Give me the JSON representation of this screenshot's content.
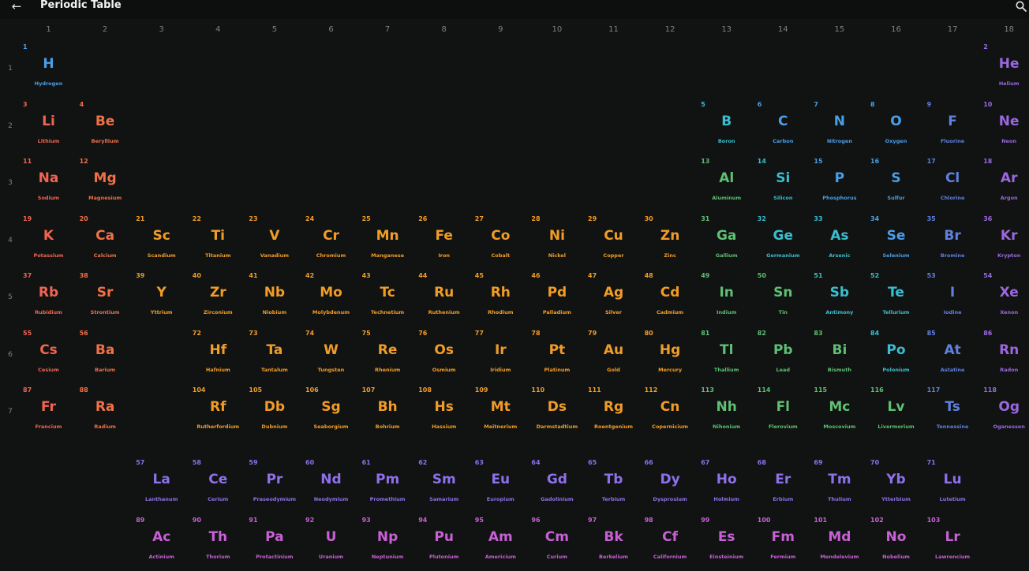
{
  "header": {
    "title": "Periodic Table",
    "back_icon": "arrow-left-icon",
    "search_icon": "search-icon"
  },
  "groups": [
    "1",
    "2",
    "3",
    "4",
    "5",
    "6",
    "7",
    "8",
    "9",
    "10",
    "11",
    "12",
    "13",
    "14",
    "15",
    "16",
    "17",
    "18"
  ],
  "periods": [
    "1",
    "2",
    "3",
    "4",
    "5",
    "6",
    "7"
  ],
  "colors": {
    "alkali": "#f06452",
    "alkaline": "#f07048",
    "transition": "#f29c28",
    "post": "#5fbf75",
    "metalloid": "#3bbdd0",
    "nonmetal": "#4a9ee8",
    "halogen": "#6080e0",
    "noble": "#9a68e0",
    "lanthanide": "#8f70ec",
    "actinide": "#c860d6"
  },
  "elements": [
    {
      "n": "1",
      "s": "H",
      "name": "Hydrogen",
      "g": 1,
      "p": 1,
      "c": "nonmetal"
    },
    {
      "n": "2",
      "s": "He",
      "name": "Helium",
      "g": 18,
      "p": 1,
      "c": "noble"
    },
    {
      "n": "3",
      "s": "Li",
      "name": "Lithium",
      "g": 1,
      "p": 2,
      "c": "alkali"
    },
    {
      "n": "4",
      "s": "Be",
      "name": "Beryllium",
      "g": 2,
      "p": 2,
      "c": "alkaline"
    },
    {
      "n": "5",
      "s": "B",
      "name": "Boron",
      "g": 13,
      "p": 2,
      "c": "metalloid"
    },
    {
      "n": "6",
      "s": "C",
      "name": "Carbon",
      "g": 14,
      "p": 2,
      "c": "nonmetal"
    },
    {
      "n": "7",
      "s": "N",
      "name": "Nitrogen",
      "g": 15,
      "p": 2,
      "c": "nonmetal"
    },
    {
      "n": "8",
      "s": "O",
      "name": "Oxygen",
      "g": 16,
      "p": 2,
      "c": "nonmetal"
    },
    {
      "n": "9",
      "s": "F",
      "name": "Fluorine",
      "g": 17,
      "p": 2,
      "c": "halogen"
    },
    {
      "n": "10",
      "s": "Ne",
      "name": "Neon",
      "g": 18,
      "p": 2,
      "c": "noble"
    },
    {
      "n": "11",
      "s": "Na",
      "name": "Sodium",
      "g": 1,
      "p": 3,
      "c": "alkali"
    },
    {
      "n": "12",
      "s": "Mg",
      "name": "Magnesium",
      "g": 2,
      "p": 3,
      "c": "alkaline"
    },
    {
      "n": "13",
      "s": "Al",
      "name": "Aluminum",
      "g": 13,
      "p": 3,
      "c": "post"
    },
    {
      "n": "14",
      "s": "Si",
      "name": "Silicon",
      "g": 14,
      "p": 3,
      "c": "metalloid"
    },
    {
      "n": "15",
      "s": "P",
      "name": "Phosphorus",
      "g": 15,
      "p": 3,
      "c": "nonmetal"
    },
    {
      "n": "16",
      "s": "S",
      "name": "Sulfur",
      "g": 16,
      "p": 3,
      "c": "nonmetal"
    },
    {
      "n": "17",
      "s": "Cl",
      "name": "Chlorine",
      "g": 17,
      "p": 3,
      "c": "halogen"
    },
    {
      "n": "18",
      "s": "Ar",
      "name": "Argon",
      "g": 18,
      "p": 3,
      "c": "noble"
    },
    {
      "n": "19",
      "s": "K",
      "name": "Potassium",
      "g": 1,
      "p": 4,
      "c": "alkali"
    },
    {
      "n": "20",
      "s": "Ca",
      "name": "Calcium",
      "g": 2,
      "p": 4,
      "c": "alkaline"
    },
    {
      "n": "21",
      "s": "Sc",
      "name": "Scandium",
      "g": 3,
      "p": 4,
      "c": "transition"
    },
    {
      "n": "22",
      "s": "Ti",
      "name": "Titanium",
      "g": 4,
      "p": 4,
      "c": "transition"
    },
    {
      "n": "23",
      "s": "V",
      "name": "Vanadium",
      "g": 5,
      "p": 4,
      "c": "transition"
    },
    {
      "n": "24",
      "s": "Cr",
      "name": "Chromium",
      "g": 6,
      "p": 4,
      "c": "transition"
    },
    {
      "n": "25",
      "s": "Mn",
      "name": "Manganese",
      "g": 7,
      "p": 4,
      "c": "transition"
    },
    {
      "n": "26",
      "s": "Fe",
      "name": "Iron",
      "g": 8,
      "p": 4,
      "c": "transition"
    },
    {
      "n": "27",
      "s": "Co",
      "name": "Cobalt",
      "g": 9,
      "p": 4,
      "c": "transition"
    },
    {
      "n": "28",
      "s": "Ni",
      "name": "Nickel",
      "g": 10,
      "p": 4,
      "c": "transition"
    },
    {
      "n": "29",
      "s": "Cu",
      "name": "Copper",
      "g": 11,
      "p": 4,
      "c": "transition"
    },
    {
      "n": "30",
      "s": "Zn",
      "name": "Zinc",
      "g": 12,
      "p": 4,
      "c": "transition"
    },
    {
      "n": "31",
      "s": "Ga",
      "name": "Gallium",
      "g": 13,
      "p": 4,
      "c": "post"
    },
    {
      "n": "32",
      "s": "Ge",
      "name": "Germanium",
      "g": 14,
      "p": 4,
      "c": "metalloid"
    },
    {
      "n": "33",
      "s": "As",
      "name": "Arsenic",
      "g": 15,
      "p": 4,
      "c": "metalloid"
    },
    {
      "n": "34",
      "s": "Se",
      "name": "Selenium",
      "g": 16,
      "p": 4,
      "c": "nonmetal"
    },
    {
      "n": "35",
      "s": "Br",
      "name": "Bromine",
      "g": 17,
      "p": 4,
      "c": "halogen"
    },
    {
      "n": "36",
      "s": "Kr",
      "name": "Krypton",
      "g": 18,
      "p": 4,
      "c": "noble"
    },
    {
      "n": "37",
      "s": "Rb",
      "name": "Rubidium",
      "g": 1,
      "p": 5,
      "c": "alkali"
    },
    {
      "n": "38",
      "s": "Sr",
      "name": "Strontium",
      "g": 2,
      "p": 5,
      "c": "alkaline"
    },
    {
      "n": "39",
      "s": "Y",
      "name": "Yttrium",
      "g": 3,
      "p": 5,
      "c": "transition"
    },
    {
      "n": "40",
      "s": "Zr",
      "name": "Zirconium",
      "g": 4,
      "p": 5,
      "c": "transition"
    },
    {
      "n": "41",
      "s": "Nb",
      "name": "Niobium",
      "g": 5,
      "p": 5,
      "c": "transition"
    },
    {
      "n": "42",
      "s": "Mo",
      "name": "Molybdenum",
      "g": 6,
      "p": 5,
      "c": "transition"
    },
    {
      "n": "43",
      "s": "Tc",
      "name": "Technetium",
      "g": 7,
      "p": 5,
      "c": "transition"
    },
    {
      "n": "44",
      "s": "Ru",
      "name": "Ruthenium",
      "g": 8,
      "p": 5,
      "c": "transition"
    },
    {
      "n": "45",
      "s": "Rh",
      "name": "Rhodium",
      "g": 9,
      "p": 5,
      "c": "transition"
    },
    {
      "n": "46",
      "s": "Pd",
      "name": "Palladium",
      "g": 10,
      "p": 5,
      "c": "transition"
    },
    {
      "n": "47",
      "s": "Ag",
      "name": "Silver",
      "g": 11,
      "p": 5,
      "c": "transition"
    },
    {
      "n": "48",
      "s": "Cd",
      "name": "Cadmium",
      "g": 12,
      "p": 5,
      "c": "transition"
    },
    {
      "n": "49",
      "s": "In",
      "name": "Indium",
      "g": 13,
      "p": 5,
      "c": "post"
    },
    {
      "n": "50",
      "s": "Sn",
      "name": "Tin",
      "g": 14,
      "p": 5,
      "c": "post"
    },
    {
      "n": "51",
      "s": "Sb",
      "name": "Antimony",
      "g": 15,
      "p": 5,
      "c": "metalloid"
    },
    {
      "n": "52",
      "s": "Te",
      "name": "Tellurium",
      "g": 16,
      "p": 5,
      "c": "metalloid"
    },
    {
      "n": "53",
      "s": "I",
      "name": "Iodine",
      "g": 17,
      "p": 5,
      "c": "halogen"
    },
    {
      "n": "54",
      "s": "Xe",
      "name": "Xenon",
      "g": 18,
      "p": 5,
      "c": "noble"
    },
    {
      "n": "55",
      "s": "Cs",
      "name": "Cesium",
      "g": 1,
      "p": 6,
      "c": "alkali"
    },
    {
      "n": "56",
      "s": "Ba",
      "name": "Barium",
      "g": 2,
      "p": 6,
      "c": "alkaline"
    },
    {
      "n": "72",
      "s": "Hf",
      "name": "Hafnium",
      "g": 4,
      "p": 6,
      "c": "transition"
    },
    {
      "n": "73",
      "s": "Ta",
      "name": "Tantalum",
      "g": 5,
      "p": 6,
      "c": "transition"
    },
    {
      "n": "74",
      "s": "W",
      "name": "Tungsten",
      "g": 6,
      "p": 6,
      "c": "transition"
    },
    {
      "n": "75",
      "s": "Re",
      "name": "Rhenium",
      "g": 7,
      "p": 6,
      "c": "transition"
    },
    {
      "n": "76",
      "s": "Os",
      "name": "Osmium",
      "g": 8,
      "p": 6,
      "c": "transition"
    },
    {
      "n": "77",
      "s": "Ir",
      "name": "Iridium",
      "g": 9,
      "p": 6,
      "c": "transition"
    },
    {
      "n": "78",
      "s": "Pt",
      "name": "Platinum",
      "g": 10,
      "p": 6,
      "c": "transition"
    },
    {
      "n": "79",
      "s": "Au",
      "name": "Gold",
      "g": 11,
      "p": 6,
      "c": "transition"
    },
    {
      "n": "80",
      "s": "Hg",
      "name": "Mercury",
      "g": 12,
      "p": 6,
      "c": "transition"
    },
    {
      "n": "81",
      "s": "Tl",
      "name": "Thallium",
      "g": 13,
      "p": 6,
      "c": "post"
    },
    {
      "n": "82",
      "s": "Pb",
      "name": "Lead",
      "g": 14,
      "p": 6,
      "c": "post"
    },
    {
      "n": "83",
      "s": "Bi",
      "name": "Bismuth",
      "g": 15,
      "p": 6,
      "c": "post"
    },
    {
      "n": "84",
      "s": "Po",
      "name": "Polonium",
      "g": 16,
      "p": 6,
      "c": "metalloid"
    },
    {
      "n": "85",
      "s": "At",
      "name": "Astatine",
      "g": 17,
      "p": 6,
      "c": "halogen"
    },
    {
      "n": "86",
      "s": "Rn",
      "name": "Radon",
      "g": 18,
      "p": 6,
      "c": "noble"
    },
    {
      "n": "87",
      "s": "Fr",
      "name": "Francium",
      "g": 1,
      "p": 7,
      "c": "alkali"
    },
    {
      "n": "88",
      "s": "Ra",
      "name": "Radium",
      "g": 2,
      "p": 7,
      "c": "alkaline"
    },
    {
      "n": "104",
      "s": "Rf",
      "name": "Rutherfordium",
      "g": 4,
      "p": 7,
      "c": "transition"
    },
    {
      "n": "105",
      "s": "Db",
      "name": "Dubnium",
      "g": 5,
      "p": 7,
      "c": "transition"
    },
    {
      "n": "106",
      "s": "Sg",
      "name": "Seaborgium",
      "g": 6,
      "p": 7,
      "c": "transition"
    },
    {
      "n": "107",
      "s": "Bh",
      "name": "Bohrium",
      "g": 7,
      "p": 7,
      "c": "transition"
    },
    {
      "n": "108",
      "s": "Hs",
      "name": "Hassium",
      "g": 8,
      "p": 7,
      "c": "transition"
    },
    {
      "n": "109",
      "s": "Mt",
      "name": "Meitnerium",
      "g": 9,
      "p": 7,
      "c": "transition"
    },
    {
      "n": "110",
      "s": "Ds",
      "name": "Darmstadtium",
      "g": 10,
      "p": 7,
      "c": "transition"
    },
    {
      "n": "111",
      "s": "Rg",
      "name": "Roentgenium",
      "g": 11,
      "p": 7,
      "c": "transition"
    },
    {
      "n": "112",
      "s": "Cn",
      "name": "Copernicium",
      "g": 12,
      "p": 7,
      "c": "transition"
    },
    {
      "n": "113",
      "s": "Nh",
      "name": "Nihonium",
      "g": 13,
      "p": 7,
      "c": "post"
    },
    {
      "n": "114",
      "s": "Fl",
      "name": "Flerovium",
      "g": 14,
      "p": 7,
      "c": "post"
    },
    {
      "n": "115",
      "s": "Mc",
      "name": "Moscovium",
      "g": 15,
      "p": 7,
      "c": "post"
    },
    {
      "n": "116",
      "s": "Lv",
      "name": "Livermorium",
      "g": 16,
      "p": 7,
      "c": "post"
    },
    {
      "n": "117",
      "s": "Ts",
      "name": "Tennessine",
      "g": 17,
      "p": 7,
      "c": "halogen"
    },
    {
      "n": "118",
      "s": "Og",
      "name": "Oganesson",
      "g": 18,
      "p": 7,
      "c": "noble"
    },
    {
      "n": "57",
      "s": "La",
      "name": "Lanthanum",
      "g": 3,
      "p": 8,
      "c": "lanthanide"
    },
    {
      "n": "58",
      "s": "Ce",
      "name": "Cerium",
      "g": 4,
      "p": 8,
      "c": "lanthanide"
    },
    {
      "n": "59",
      "s": "Pr",
      "name": "Praseodymium",
      "g": 5,
      "p": 8,
      "c": "lanthanide"
    },
    {
      "n": "60",
      "s": "Nd",
      "name": "Neodymium",
      "g": 6,
      "p": 8,
      "c": "lanthanide"
    },
    {
      "n": "61",
      "s": "Pm",
      "name": "Promethium",
      "g": 7,
      "p": 8,
      "c": "lanthanide"
    },
    {
      "n": "62",
      "s": "Sm",
      "name": "Samarium",
      "g": 8,
      "p": 8,
      "c": "lanthanide"
    },
    {
      "n": "63",
      "s": "Eu",
      "name": "Europium",
      "g": 9,
      "p": 8,
      "c": "lanthanide"
    },
    {
      "n": "64",
      "s": "Gd",
      "name": "Gadolinium",
      "g": 10,
      "p": 8,
      "c": "lanthanide"
    },
    {
      "n": "65",
      "s": "Tb",
      "name": "Terbium",
      "g": 11,
      "p": 8,
      "c": "lanthanide"
    },
    {
      "n": "66",
      "s": "Dy",
      "name": "Dysprosium",
      "g": 12,
      "p": 8,
      "c": "lanthanide"
    },
    {
      "n": "67",
      "s": "Ho",
      "name": "Holmium",
      "g": 13,
      "p": 8,
      "c": "lanthanide"
    },
    {
      "n": "68",
      "s": "Er",
      "name": "Erbium",
      "g": 14,
      "p": 8,
      "c": "lanthanide"
    },
    {
      "n": "69",
      "s": "Tm",
      "name": "Thulium",
      "g": 15,
      "p": 8,
      "c": "lanthanide"
    },
    {
      "n": "70",
      "s": "Yb",
      "name": "Ytterbium",
      "g": 16,
      "p": 8,
      "c": "lanthanide"
    },
    {
      "n": "71",
      "s": "Lu",
      "name": "Lutetium",
      "g": 17,
      "p": 8,
      "c": "lanthanide"
    },
    {
      "n": "89",
      "s": "Ac",
      "name": "Actinium",
      "g": 3,
      "p": 9,
      "c": "actinide"
    },
    {
      "n": "90",
      "s": "Th",
      "name": "Thorium",
      "g": 4,
      "p": 9,
      "c": "actinide"
    },
    {
      "n": "91",
      "s": "Pa",
      "name": "Protactinium",
      "g": 5,
      "p": 9,
      "c": "actinide"
    },
    {
      "n": "92",
      "s": "U",
      "name": "Uranium",
      "g": 6,
      "p": 9,
      "c": "actinide"
    },
    {
      "n": "93",
      "s": "Np",
      "name": "Neptunium",
      "g": 7,
      "p": 9,
      "c": "actinide"
    },
    {
      "n": "94",
      "s": "Pu",
      "name": "Plutonium",
      "g": 8,
      "p": 9,
      "c": "actinide"
    },
    {
      "n": "95",
      "s": "Am",
      "name": "Americium",
      "g": 9,
      "p": 9,
      "c": "actinide"
    },
    {
      "n": "96",
      "s": "Cm",
      "name": "Curium",
      "g": 10,
      "p": 9,
      "c": "actinide"
    },
    {
      "n": "97",
      "s": "Bk",
      "name": "Berkelium",
      "g": 11,
      "p": 9,
      "c": "actinide"
    },
    {
      "n": "98",
      "s": "Cf",
      "name": "Californium",
      "g": 12,
      "p": 9,
      "c": "actinide"
    },
    {
      "n": "99",
      "s": "Es",
      "name": "Einsteinium",
      "g": 13,
      "p": 9,
      "c": "actinide"
    },
    {
      "n": "100",
      "s": "Fm",
      "name": "Fermium",
      "g": 14,
      "p": 9,
      "c": "actinide"
    },
    {
      "n": "101",
      "s": "Md",
      "name": "Mendelevium",
      "g": 15,
      "p": 9,
      "c": "actinide"
    },
    {
      "n": "102",
      "s": "No",
      "name": "Nobelium",
      "g": 16,
      "p": 9,
      "c": "actinide"
    },
    {
      "n": "103",
      "s": "Lr",
      "name": "Lawrencium",
      "g": 17,
      "p": 9,
      "c": "actinide"
    }
  ]
}
